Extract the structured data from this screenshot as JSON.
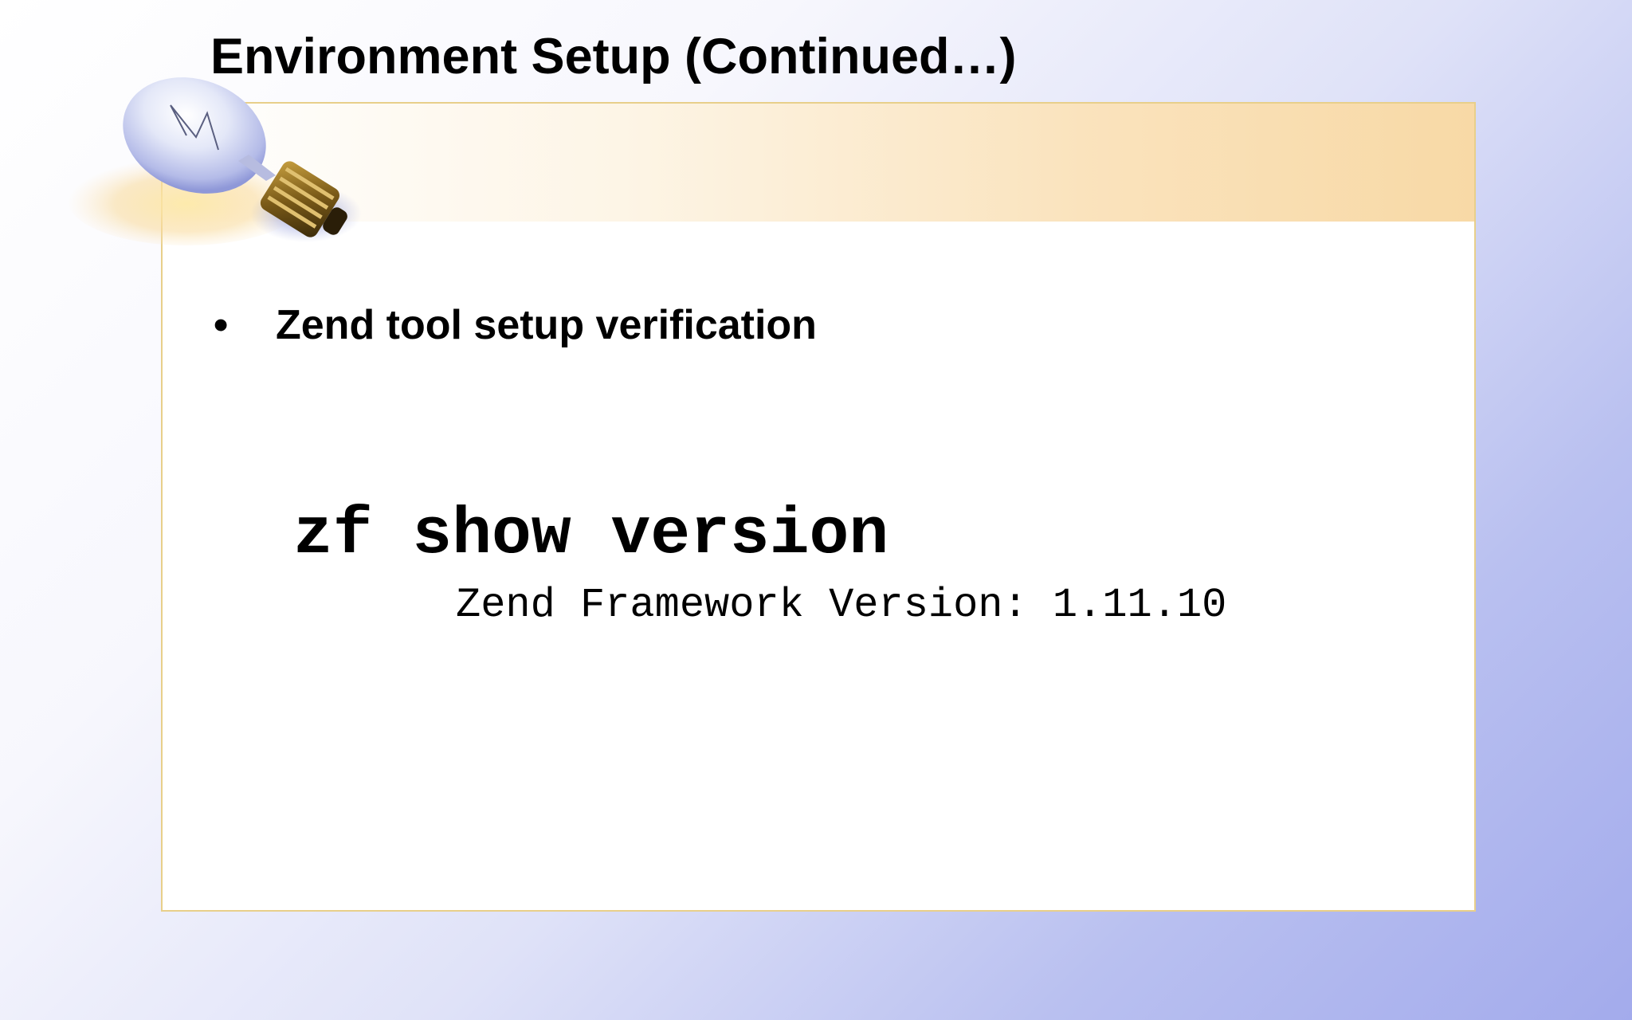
{
  "slide": {
    "title": "Environment Setup (Continued…)",
    "bullet": {
      "marker": "•",
      "text": "Zend tool setup verification"
    },
    "command": "zf show version",
    "output": "Zend Framework Version: 1.11.10"
  },
  "decoration": {
    "icon": "lightbulb-icon"
  },
  "colors": {
    "frame_border": "#e8cf8a",
    "title_band": "#f8d9a6",
    "background_accent": "#a3abec"
  }
}
